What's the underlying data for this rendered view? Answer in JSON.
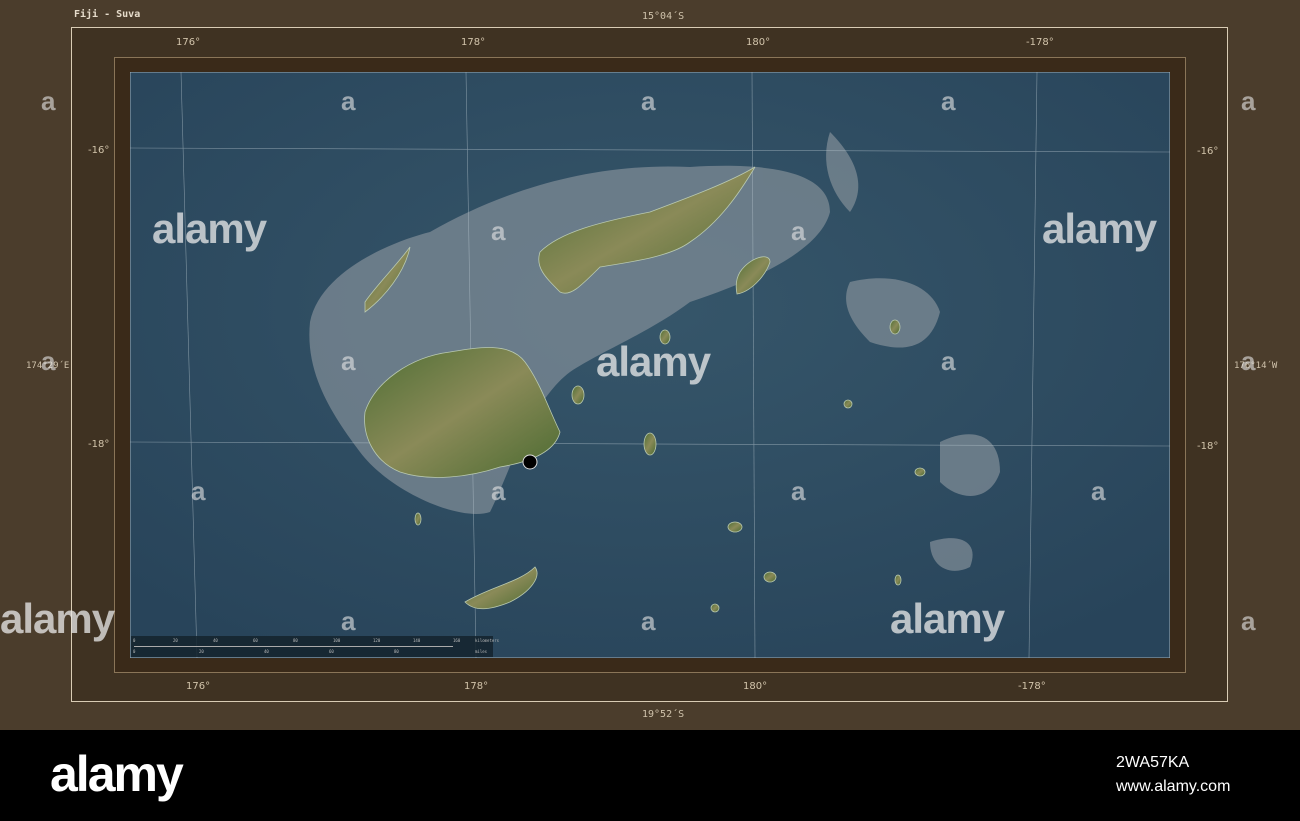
{
  "title": "Fiji - Suva",
  "extent": {
    "north": "15°04´S",
    "south": "19°52´S",
    "west": "174°29´E",
    "east": "176°14´W"
  },
  "longitude_ticks": [
    "176°",
    "178°",
    "180°",
    "-178°"
  ],
  "latitude_ticks": [
    "-16°",
    "-18°"
  ],
  "capital": {
    "name": "Suva",
    "marker_color": "#000000"
  },
  "scale_bar": {
    "km_labels": [
      "0",
      "20",
      "40",
      "60",
      "80",
      "100",
      "120",
      "140",
      "160"
    ],
    "km_unit": "kilometers",
    "mi_labels": [
      "0",
      "20",
      "40",
      "60",
      "80"
    ],
    "mi_unit": "miles"
  },
  "colors": {
    "frame": "#4b3d2c",
    "ocean": "#2e4b60",
    "shelf": "#7f8c95",
    "land": "#5f7a3c"
  },
  "watermark": {
    "text": "alamy",
    "letter": "a"
  },
  "footer": {
    "logo": "alamy",
    "image_id": "2WA57KA",
    "url": "www.alamy.com"
  }
}
